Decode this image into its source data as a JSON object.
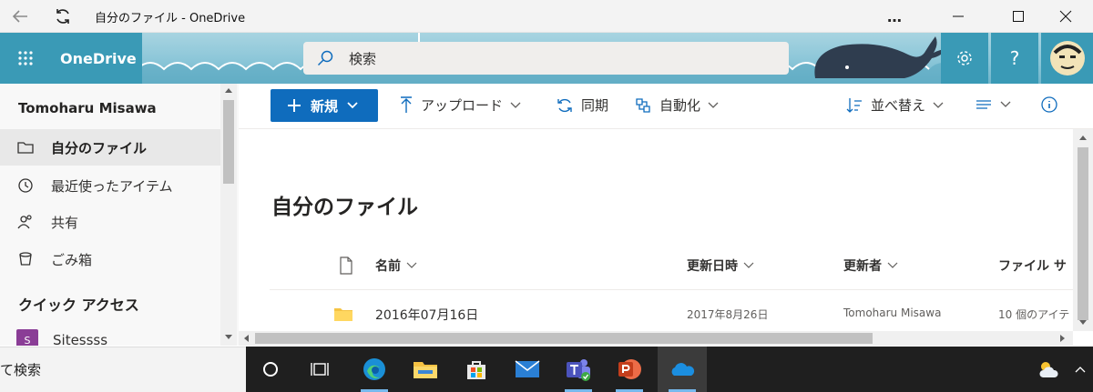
{
  "window": {
    "title": "自分のファイル - OneDrive",
    "more_label": "…"
  },
  "header": {
    "brand": "OneDrive",
    "search_placeholder": "検索",
    "help_label": "?"
  },
  "sidebar": {
    "user_name": "Tomoharu Misawa",
    "items": [
      {
        "label": "自分のファイル",
        "icon": "folder-icon",
        "active": true
      },
      {
        "label": "最近使ったアイテム",
        "icon": "history-icon",
        "active": false
      },
      {
        "label": "共有",
        "icon": "people-icon",
        "active": false
      },
      {
        "label": "ごみ箱",
        "icon": "recycle-bin-icon",
        "active": false
      }
    ],
    "quick_access_title": "クイック アクセス",
    "sites": [
      {
        "badge": "S",
        "label": "Sitessss",
        "color": "#8a3d96"
      }
    ]
  },
  "commands": {
    "new_label": "新規",
    "upload_label": "アップロード",
    "sync_label": "同期",
    "automate_label": "自動化",
    "sort_label": "並べ替え"
  },
  "main": {
    "title": "自分のファイル",
    "columns": {
      "name": "名前",
      "modified": "更新日時",
      "modified_by": "更新者",
      "file_size": "ファイル サ"
    },
    "rows": [
      {
        "name": "2016年07月16日",
        "modified": "2017年8月26日",
        "modified_by": "Tomoharu Misawa",
        "file_size": "10 個のアイテ"
      }
    ]
  },
  "taskbar": {
    "search_text": "て検索",
    "apps": [
      "cortana-icon",
      "task-view-icon",
      "edge-icon",
      "file-explorer-icon",
      "store-icon",
      "mail-icon",
      "teams-icon",
      "powerpoint-icon",
      "onedrive-icon"
    ]
  },
  "colors": {
    "brand": "#3a9ab6",
    "primary_button": "#0f6cbd",
    "folder": "#f5c342"
  }
}
